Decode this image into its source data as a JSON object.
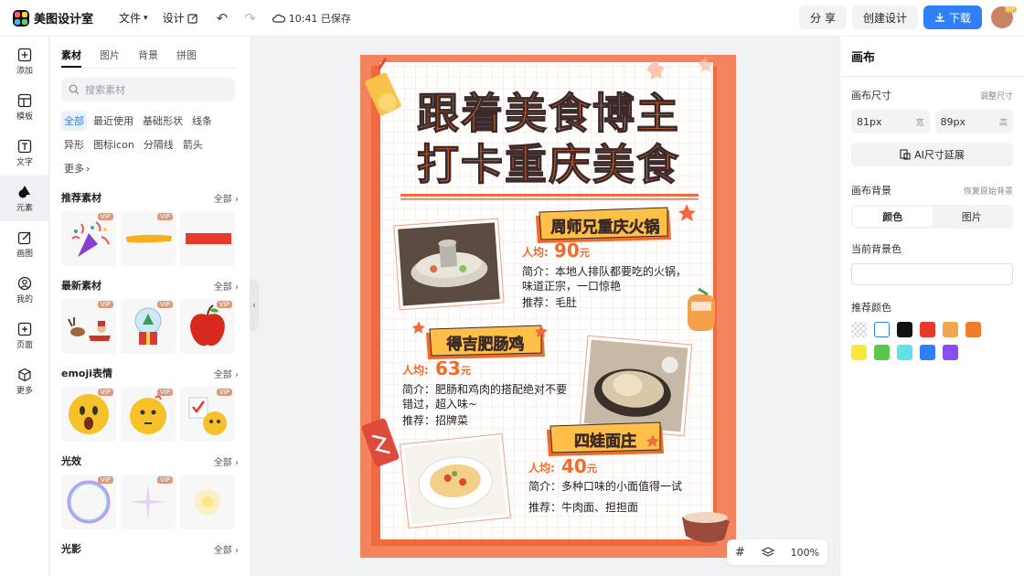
{
  "topbar": {
    "app_name": "美图设计室",
    "menu_file": "文件",
    "menu_design": "设计",
    "saved_status": "10:41 已保存",
    "share_label": "分 享",
    "create_label": "创建设计",
    "download_label": "下载",
    "avatar_badge": "VIP"
  },
  "leftnav": [
    {
      "label": "添加",
      "icon": "plus-square-icon"
    },
    {
      "label": "模板",
      "icon": "template-icon"
    },
    {
      "label": "文字",
      "icon": "text-icon"
    },
    {
      "label": "元素",
      "icon": "shapes-icon"
    },
    {
      "label": "画图",
      "icon": "draw-icon"
    },
    {
      "label": "我的",
      "icon": "user-icon"
    },
    {
      "label": "页面",
      "icon": "page-icon"
    },
    {
      "label": "更多",
      "icon": "cube-icon"
    }
  ],
  "panel": {
    "tabs": [
      "素材",
      "图片",
      "背景",
      "拼图"
    ],
    "search_placeholder": "搜索素材",
    "chips": [
      "全部",
      "最近使用",
      "基础形状",
      "线条",
      "异形",
      "图标icon",
      "分隔线",
      "箭头",
      "更多"
    ],
    "all_label": "全部",
    "vip_label": "VIP",
    "sections": [
      "推荐素材",
      "最新素材",
      "emoji表情",
      "光效",
      "光影"
    ]
  },
  "right": {
    "title": "画布",
    "size_label": "画布尺寸",
    "adjust_size": "调整尺寸",
    "width_value": "81px",
    "width_unit": "宽",
    "height_value": "89px",
    "height_unit": "高",
    "ai_extend": "AI尺寸延展",
    "bg_label": "画布背景",
    "restore_bg": "恢复原始背景",
    "seg_color": "颜色",
    "seg_image": "图片",
    "current_bg": "当前背景色",
    "recommended": "推荐颜色",
    "swatches": [
      "transparent",
      "#ffffff",
      "#111111",
      "#e8392b",
      "#f0a64a",
      "#ef7d2a",
      "#f7e83a",
      "#59c84a",
      "#5fe3e6",
      "#2f7ff6",
      "#8a4df0"
    ]
  },
  "zoom": {
    "value": "100%"
  },
  "poster": {
    "title1": "跟着美食博主",
    "title2": "打卡重庆美食",
    "item1_name": "周师兄重庆火锅",
    "item1_price_label": "人均:",
    "item1_price": "90",
    "item1_unit": "元",
    "item1_desc1": "简介：本地人排队都要吃的火锅，",
    "item1_desc2": "味道正宗，一口惊艳",
    "item1_rec": "推荐：毛肚",
    "item2_name": "得吉肥肠鸡",
    "item2_price_label": "人均:",
    "item2_price": "63",
    "item2_unit": "元",
    "item2_desc1": "简介：肥肠和鸡肉的搭配绝对不要",
    "item2_desc2": "错过，超入味~",
    "item2_rec": "推荐：招牌菜",
    "item3_name": "四娃面庄",
    "item3_price_label": "人均:",
    "item3_price": "40",
    "item3_unit": "元",
    "item3_desc1": "简介：多种口味的小面值得一试",
    "item3_rec": "推荐：牛肉面、担担面"
  },
  "colors": {
    "accent": "#2f7ff6",
    "poster_orange": "#f4845f",
    "title_orange": "#f26a2a"
  }
}
